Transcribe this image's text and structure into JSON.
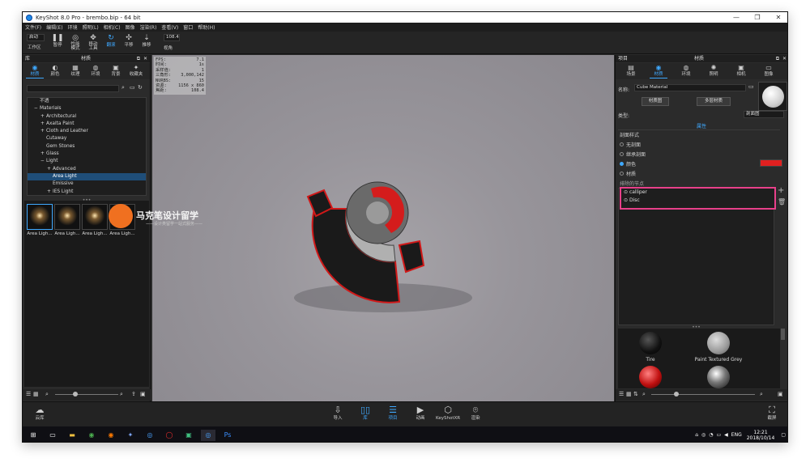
{
  "window": {
    "title": "KeyShot 8.0 Pro  -  brembo.bip  -  64 bit"
  },
  "menu": [
    "文件(F)",
    "编辑(E)",
    "环境",
    "照明(L)",
    "相机(C)",
    "图像",
    "渲染(R)",
    "查看(V)",
    "窗口",
    "帮助(H)"
  ],
  "toolbar": {
    "workspace_value": "启动",
    "workspace_label": "工作区",
    "items": [
      {
        "icon": "pause-icon",
        "label": "暂停"
      },
      {
        "icon": "performance-icon",
        "label": "性能\n模式"
      },
      {
        "icon": "move-tool-icon",
        "label": "移动\n工具"
      },
      {
        "icon": "refresh-icon",
        "label": "翻滚"
      },
      {
        "icon": "pan-icon",
        "label": "平移"
      },
      {
        "icon": "dolly-icon",
        "label": "推移"
      }
    ],
    "fov_value": "108.4",
    "fov_label": "视角"
  },
  "library": {
    "header": "库",
    "tab_header": "材质",
    "tabs": [
      "材质",
      "颜色",
      "纹理",
      "环境",
      "背景",
      "收藏夹"
    ],
    "tree": [
      "不透",
      "Materials",
      "Architectural",
      "Axalta Paint",
      "Cloth and Leather",
      "Cutaway",
      "Gem Stones",
      "Glass",
      "Light",
      "Advanced",
      "Area Light",
      "Emissive",
      "IES Light"
    ],
    "tree_prefix": [
      "",
      "−",
      "+",
      "+",
      "+",
      "",
      "",
      "+",
      "−",
      "+",
      "",
      "",
      "+"
    ],
    "tree_indent": [
      1,
      1,
      2,
      2,
      2,
      2,
      2,
      2,
      2,
      3,
      3,
      3,
      3
    ],
    "selected_index": 10,
    "thumbs": [
      "Area Ligh...",
      "Area Ligh...",
      "Area Ligh...",
      "Area Ligh..."
    ]
  },
  "watermark": {
    "line1": "马克笔设计留学",
    "line2": "——设计类留学一站式服务——"
  },
  "stats": [
    [
      "FPS:",
      "7.1"
    ],
    [
      "时间:",
      "1s"
    ],
    [
      "采样值:",
      "1"
    ],
    [
      "三角形:",
      "3,000,142"
    ],
    [
      "NURBS:",
      "15"
    ],
    [
      "资源:",
      "1156 x 860"
    ],
    [
      "焦距:",
      "108.4"
    ]
  ],
  "project": {
    "header": "项目",
    "tab_header": "材质",
    "tabs": [
      "场景",
      "材质",
      "环境",
      "照明",
      "相机",
      "图像"
    ],
    "name_label": "名称:",
    "name_value": "Cube Material",
    "graph_button": "材质图",
    "multi_button": "多层材质",
    "type_label": "类型:",
    "type_value": "剖面图",
    "props_tab": "属性",
    "section_label": "剖面样式",
    "options": [
      "无剖面",
      "继承剖面",
      "颜色",
      "材质"
    ],
    "selected_option": 2,
    "color": "#e02020",
    "nodes_label": "排除的节点",
    "nodes": [
      "calliper",
      "Disc"
    ],
    "materials": [
      "Tire",
      "Paint Textured Grey"
    ]
  },
  "bottom": {
    "cloud": "云库",
    "items": [
      "导入",
      "库",
      "项目",
      "动画",
      "KeyShotXR",
      "渲染"
    ],
    "active": [
      1,
      2
    ],
    "screenshot": "截屏"
  },
  "taskbar": {
    "time": "12:21",
    "date": "2018/10/14",
    "lang": "ENG"
  }
}
